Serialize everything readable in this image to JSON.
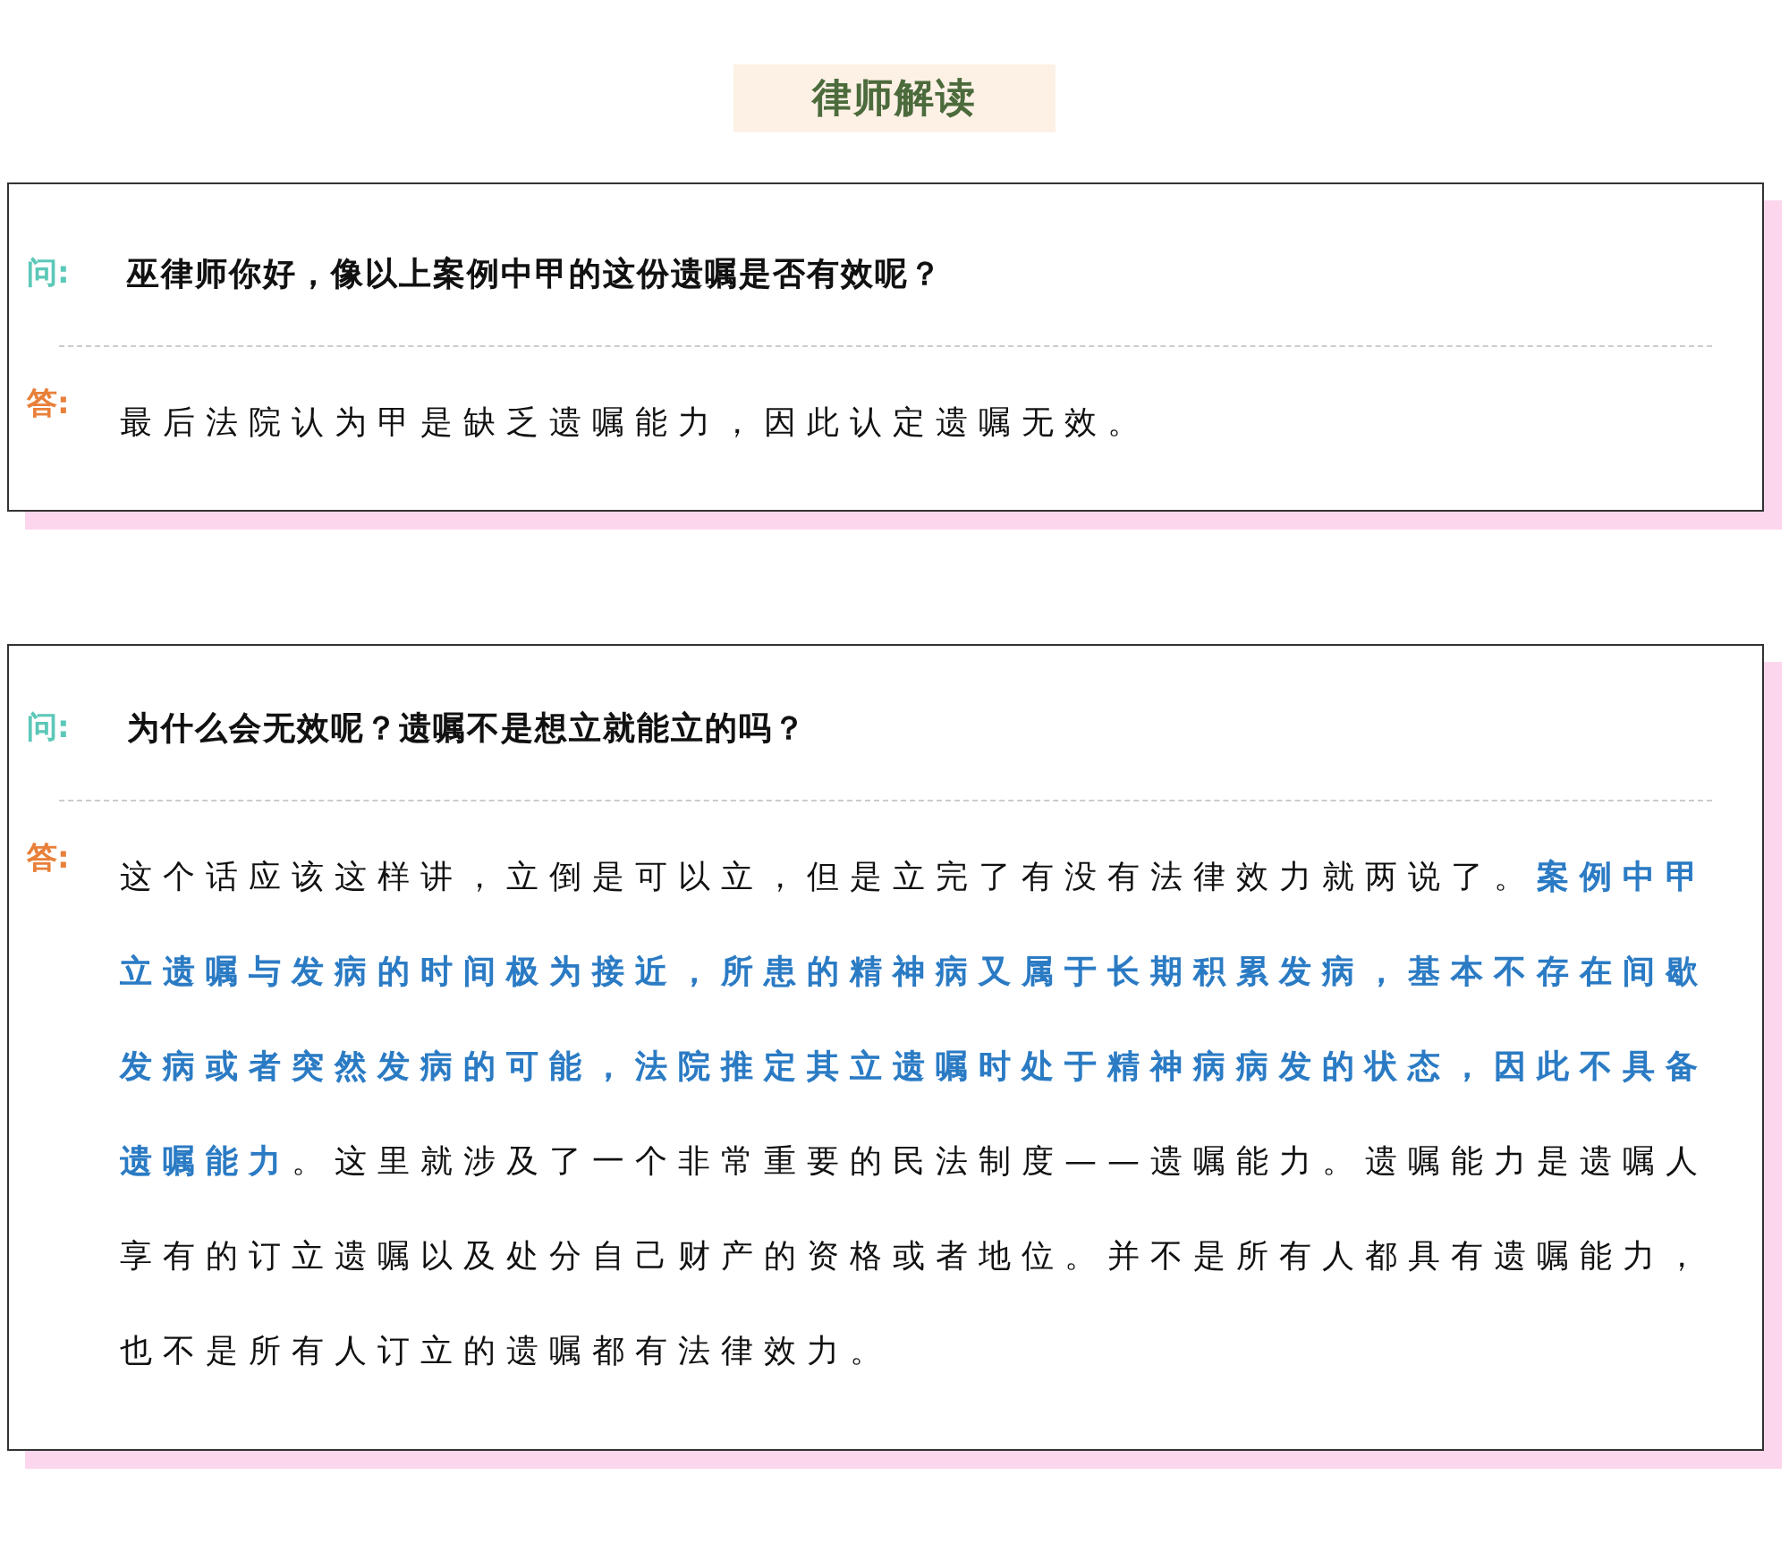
{
  "heading": "律师解读",
  "qa": [
    {
      "question_label": "问:",
      "question": "巫律师你好，像以上案例中甲的这份遗嘱是否有效呢？",
      "answer_label": "答:",
      "answer": "最后法院认为甲是缺乏遗嘱能力，因此认定遗嘱无效。"
    },
    {
      "question_label": "问:",
      "question": "为什么会无效呢？遗嘱不是想立就能立的吗？",
      "answer_label": "答:",
      "answer": "这个话应该这样讲，立倒是可以立，但是立完了有没有法律效力就两说了。**案例中甲立遗嘱与发病的时间极为接近，所患的精神病又属于长期积累发病，基本不存在间歇发病或者突然发病的可能，法院推定其立遗嘱时处于精神病病发的状态，因此不具备遗嘱能力**。这里就涉及了一个非常重要的民法制度——遗嘱能力。遗嘱能力是遗嘱人享有的订立遗嘱以及处分自己财产的资格或者地位。并不是所有人都具有遗嘱能力，也不是所有人订立的遗嘱都有法律效力。"
    }
  ]
}
